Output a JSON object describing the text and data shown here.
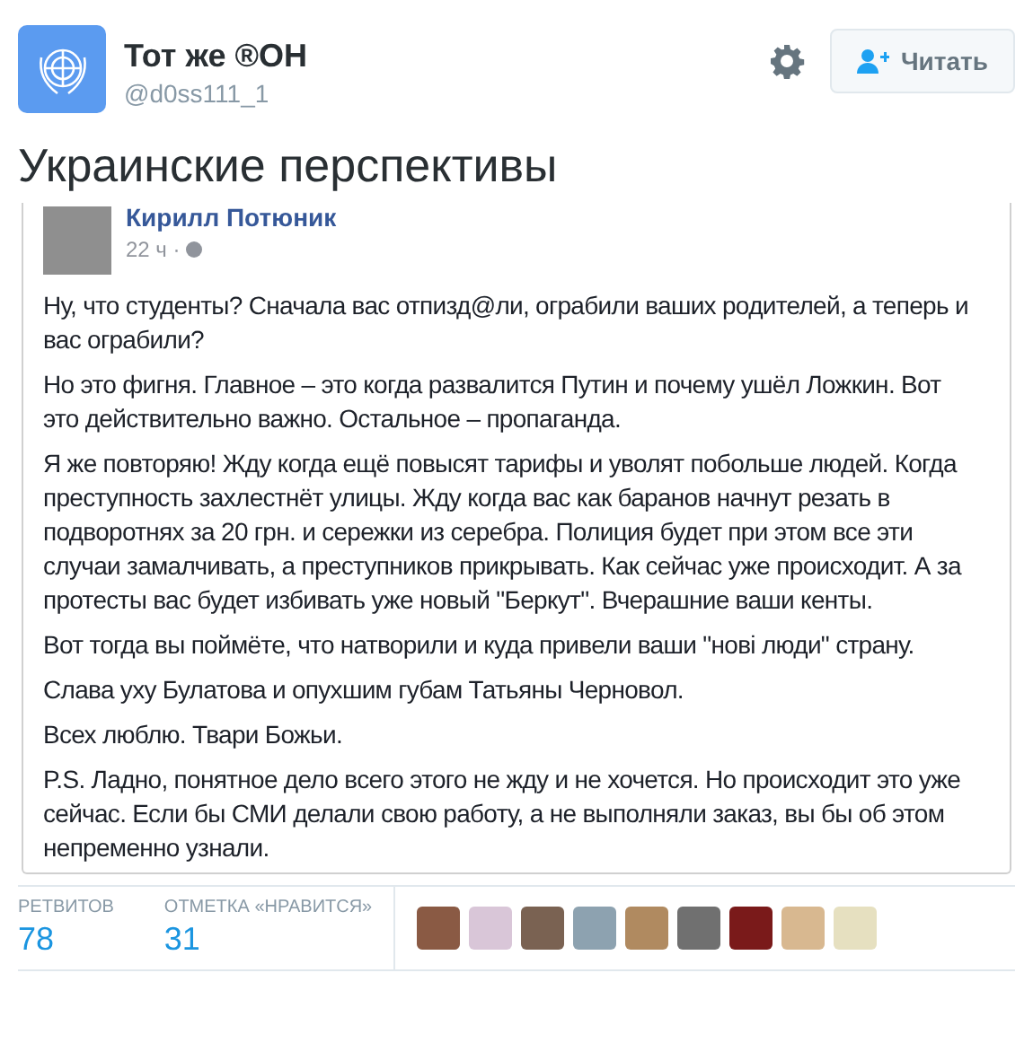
{
  "header": {
    "name": "Тот же ®ОН",
    "handle": "@d0ss111_1",
    "follow_button": "Читать"
  },
  "tweet_text": "Украинские перспективы",
  "embedded_post": {
    "author": "Кирилл Потюник",
    "time": "22 ч ·",
    "paragraphs": [
      "Ну, что студенты? Сначала вас отпизд@ли, ограбили ваших родителей, а теперь и вас ограбили?",
      "Но это фигня. Главное – это когда развалится Путин и почему ушёл Ложкин. Вот это действительно важно. Остальное – пропаганда.",
      "Я же повторяю! Жду когда ещё повысят тарифы и уволят побольше людей. Когда преступность захлестнёт улицы. Жду когда вас как баранов начнут резать в подворотнях за 20 грн. и сережки из серебра. Полиция будет при этом все эти случаи замалчивать, а преступников прикрывать. Как сейчас уже происходит. А за протесты вас будет избивать уже новый \"Беркут\". Вчерашние ваши кенты.",
      "Вот тогда вы поймёте, что натворили и куда привели ваши \"нові люди\" страну.",
      "Слава уху Булатова и опухшим губам Татьяны Черновол.",
      "Всех люблю. Твари Божьи.",
      "P.S. Ладно, понятное дело всего этого не жду и не хочется. Но происходит это уже сейчас. Если бы СМИ делали свою работу, а не выполняли заказ, вы бы об этом непременно узнали."
    ]
  },
  "stats": [
    {
      "label": "РЕТВИТОВ",
      "value": "78"
    },
    {
      "label": "ОТМЕТКА «НРАВИТСЯ»",
      "value": "31"
    }
  ],
  "likers": [
    {
      "color": "#8a5a44"
    },
    {
      "color": "#d9c6d8"
    },
    {
      "color": "#7a6252"
    },
    {
      "color": "#8da2b0"
    },
    {
      "color": "#b08a60"
    },
    {
      "color": "#707070"
    },
    {
      "color": "#7a1a1a"
    },
    {
      "color": "#d8b890"
    },
    {
      "color": "#e6e0c0"
    }
  ]
}
